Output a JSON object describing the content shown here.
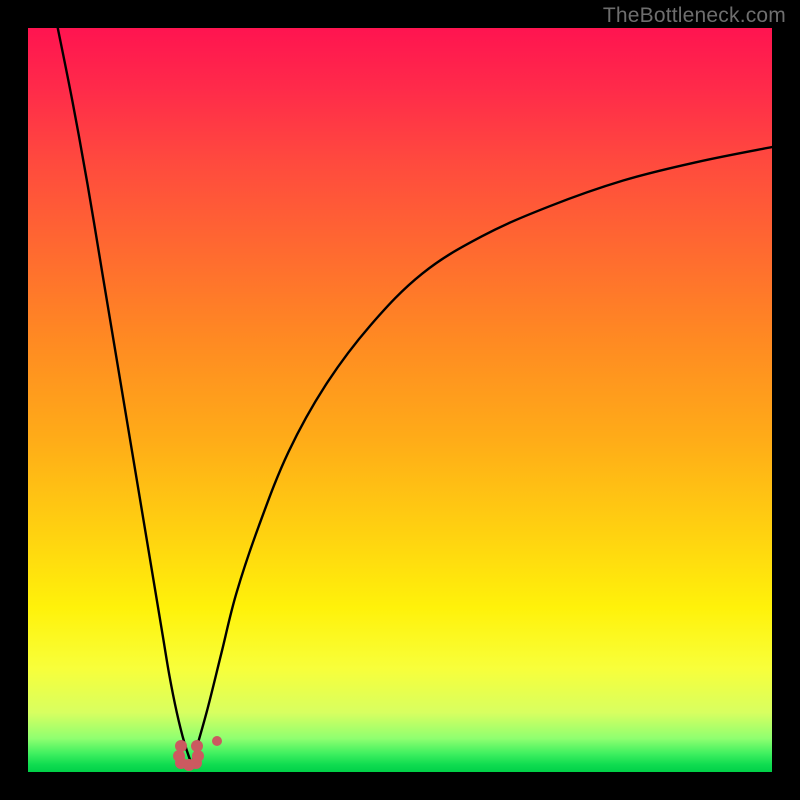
{
  "watermark": "TheBottleneck.com",
  "colors": {
    "frame": "#000000",
    "curve": "#000000",
    "marker": "#cb5a60",
    "gradient_top": "#ff1450",
    "gradient_bottom": "#00d048"
  },
  "chart_data": {
    "type": "line",
    "title": "",
    "xlabel": "",
    "ylabel": "",
    "xlim": [
      0,
      100
    ],
    "ylim": [
      0,
      100
    ],
    "grid": false,
    "legend": false,
    "note": "Bottleneck-style V curve. y≈100 means high bottleneck (red), y≈0 means no bottleneck (green). Minimum sits near x≈22.",
    "series": [
      {
        "name": "left-branch",
        "description": "Steep left arm of the V, from top-left corner down to the trough.",
        "x": [
          4,
          6,
          8,
          10,
          12,
          14,
          16,
          18,
          19,
          20,
          21,
          22
        ],
        "y": [
          100,
          90,
          79,
          67,
          55,
          43,
          31,
          19,
          13,
          8,
          4,
          1
        ]
      },
      {
        "name": "right-branch",
        "description": "Rising right arm of the V, asymptotically flattening toward the right edge.",
        "x": [
          22,
          24,
          26,
          28,
          31,
          35,
          40,
          46,
          53,
          61,
          70,
          80,
          90,
          100
        ],
        "y": [
          1,
          8,
          16,
          24,
          33,
          43,
          52,
          60,
          67,
          72,
          76,
          79.5,
          82,
          84
        ]
      }
    ],
    "markers": {
      "description": "Small U-shaped cluster of pink dots marking the bottleneck minimum and one slightly offset dot to its right.",
      "points": [
        {
          "x": 20.5,
          "y": 3.5
        },
        {
          "x": 20.3,
          "y": 2.2
        },
        {
          "x": 20.6,
          "y": 1.2
        },
        {
          "x": 21.6,
          "y": 0.9
        },
        {
          "x": 22.6,
          "y": 1.2
        },
        {
          "x": 22.9,
          "y": 2.2
        },
        {
          "x": 22.7,
          "y": 3.5
        },
        {
          "x": 25.4,
          "y": 4.2
        }
      ],
      "radius_main": 6,
      "radius_outlier": 5
    }
  }
}
